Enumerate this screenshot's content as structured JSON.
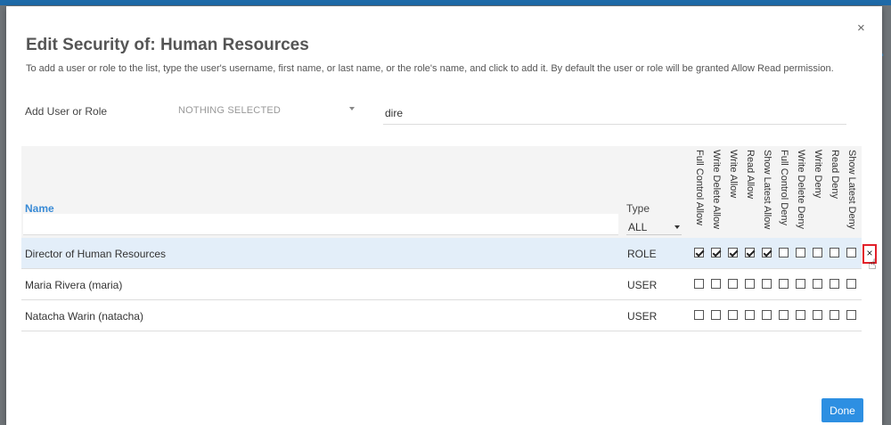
{
  "dialog": {
    "title": "Edit Security of: Human Resources",
    "description": "To add a user or role to the list, type the user's username, first name, or last name, or the role's name, and click to add it. By default the user or role will be granted Allow Read permission.",
    "close_label": "×",
    "done_label": "Done"
  },
  "add": {
    "label": "Add User or Role",
    "select_value": "NOTHING SELECTED",
    "search_value": "dire"
  },
  "table": {
    "name_header": "Name",
    "type_header": "Type",
    "type_filter": "ALL",
    "permission_headers": [
      "Full Control Allow",
      "Write Delete Allow",
      "Write Allow",
      "Read Allow",
      "Show Latest Allow",
      "Full Control Deny",
      "Write Delete Deny",
      "Write Deny",
      "Read Deny",
      "Show Latest Deny"
    ],
    "rows": [
      {
        "name": "Director of Human Resources",
        "type": "ROLE",
        "perms": [
          true,
          true,
          true,
          true,
          true,
          false,
          false,
          false,
          false,
          false
        ],
        "remove_label": "×"
      },
      {
        "name": "Maria Rivera (maria)",
        "type": "USER",
        "perms": [
          false,
          false,
          false,
          false,
          false,
          false,
          false,
          false,
          false,
          false
        ]
      },
      {
        "name": "Natacha Warin (natacha)",
        "type": "USER",
        "perms": [
          false,
          false,
          false,
          false,
          false,
          false,
          false,
          false,
          false,
          false
        ]
      }
    ]
  },
  "colors": {
    "accent": "#2d8fe2",
    "link": "#3a8bd6",
    "selected_row": "#e3eef9",
    "highlight_border": "#e2202a"
  }
}
